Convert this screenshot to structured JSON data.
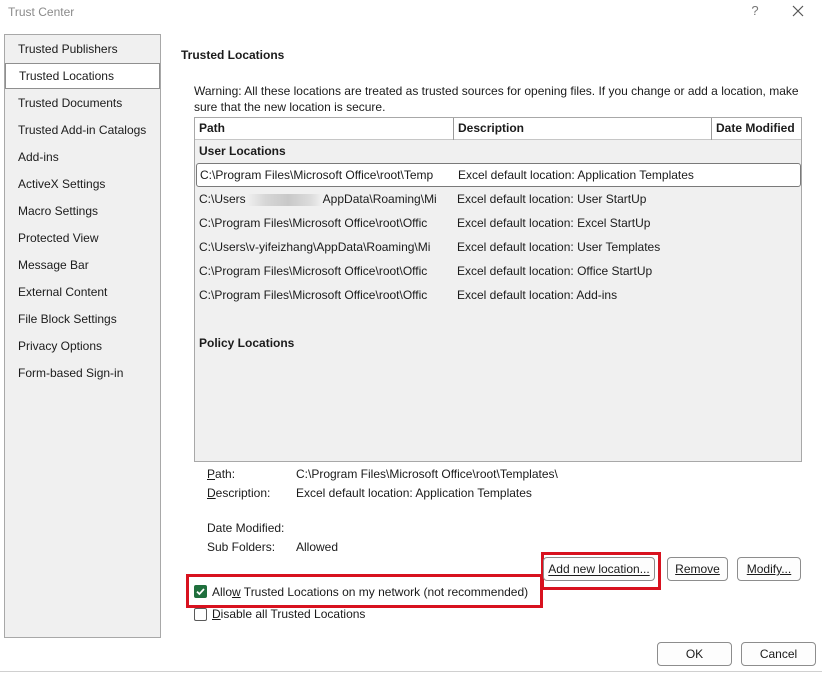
{
  "window": {
    "title": "Trust Center",
    "help_glyph": "?",
    "close_icon": "close-icon"
  },
  "sidebar": {
    "items": [
      {
        "label": "Trusted Publishers"
      },
      {
        "label": "Trusted Locations",
        "selected": true
      },
      {
        "label": "Trusted Documents"
      },
      {
        "label": "Trusted Add-in Catalogs"
      },
      {
        "label": "Add-ins"
      },
      {
        "label": "ActiveX Settings"
      },
      {
        "label": "Macro Settings"
      },
      {
        "label": "Protected View"
      },
      {
        "label": "Message Bar"
      },
      {
        "label": "External Content"
      },
      {
        "label": "File Block Settings"
      },
      {
        "label": "Privacy Options"
      },
      {
        "label": "Form-based Sign-in"
      }
    ]
  },
  "main": {
    "title": "Trusted Locations",
    "warning_line1": "Warning: All these locations are treated as trusted sources for opening files.  If you change or add a location, make",
    "warning_line2": "sure that the new location is secure.",
    "columns": [
      "Path",
      "Description",
      "Date Modified"
    ],
    "user_group_label": "User Locations",
    "policy_group_label": "Policy Locations",
    "rows": [
      {
        "path": "C:\\Program Files\\Microsoft Office\\root\\Temp",
        "description": "Excel default location: Application Templates"
      },
      {
        "path_prefix": "C:\\Users",
        "path_suffix": "AppData\\Roaming\\Mi",
        "description": "Excel default location: User StartUp"
      },
      {
        "path": "C:\\Program Files\\Microsoft Office\\root\\Offic",
        "description": "Excel default location: Excel StartUp"
      },
      {
        "path": "C:\\Users\\v-yifeizhang\\AppData\\Roaming\\Mi",
        "description": "Excel default location: User Templates"
      },
      {
        "path": "C:\\Program Files\\Microsoft Office\\root\\Offic",
        "description": "Excel default location: Office StartUp"
      },
      {
        "path": "C:\\Program Files\\Microsoft Office\\root\\Offic",
        "description": "Excel default location: Add-ins"
      }
    ]
  },
  "details": {
    "path_label": "Path:",
    "path_value": "C:\\Program Files\\Microsoft Office\\root\\Templates\\",
    "description_label": "Description:",
    "description_value": "Excel default location: Application Templates",
    "date_modified_label": "Date Modified:",
    "date_modified_value": "",
    "sub_folders_label": "Sub Folders:",
    "sub_folders_value": "Allowed"
  },
  "buttons": {
    "add_new_location": "Add new location...",
    "remove": "Remove",
    "modify": "Modify...",
    "ok": "OK",
    "cancel": "Cancel"
  },
  "options": {
    "allow_network_pre": "Allo",
    "allow_network_access_key": "w",
    "allow_network_post": " Trusted Locations on my network (not recommended)",
    "allow_network_checked": true,
    "disable_all_access_key": "D",
    "disable_all_post": "isable all Trusted Locations",
    "disable_all_checked": false
  },
  "colors": {
    "highlight_box": "#d8121f",
    "checkbox_checked": "#1f6f3d"
  }
}
